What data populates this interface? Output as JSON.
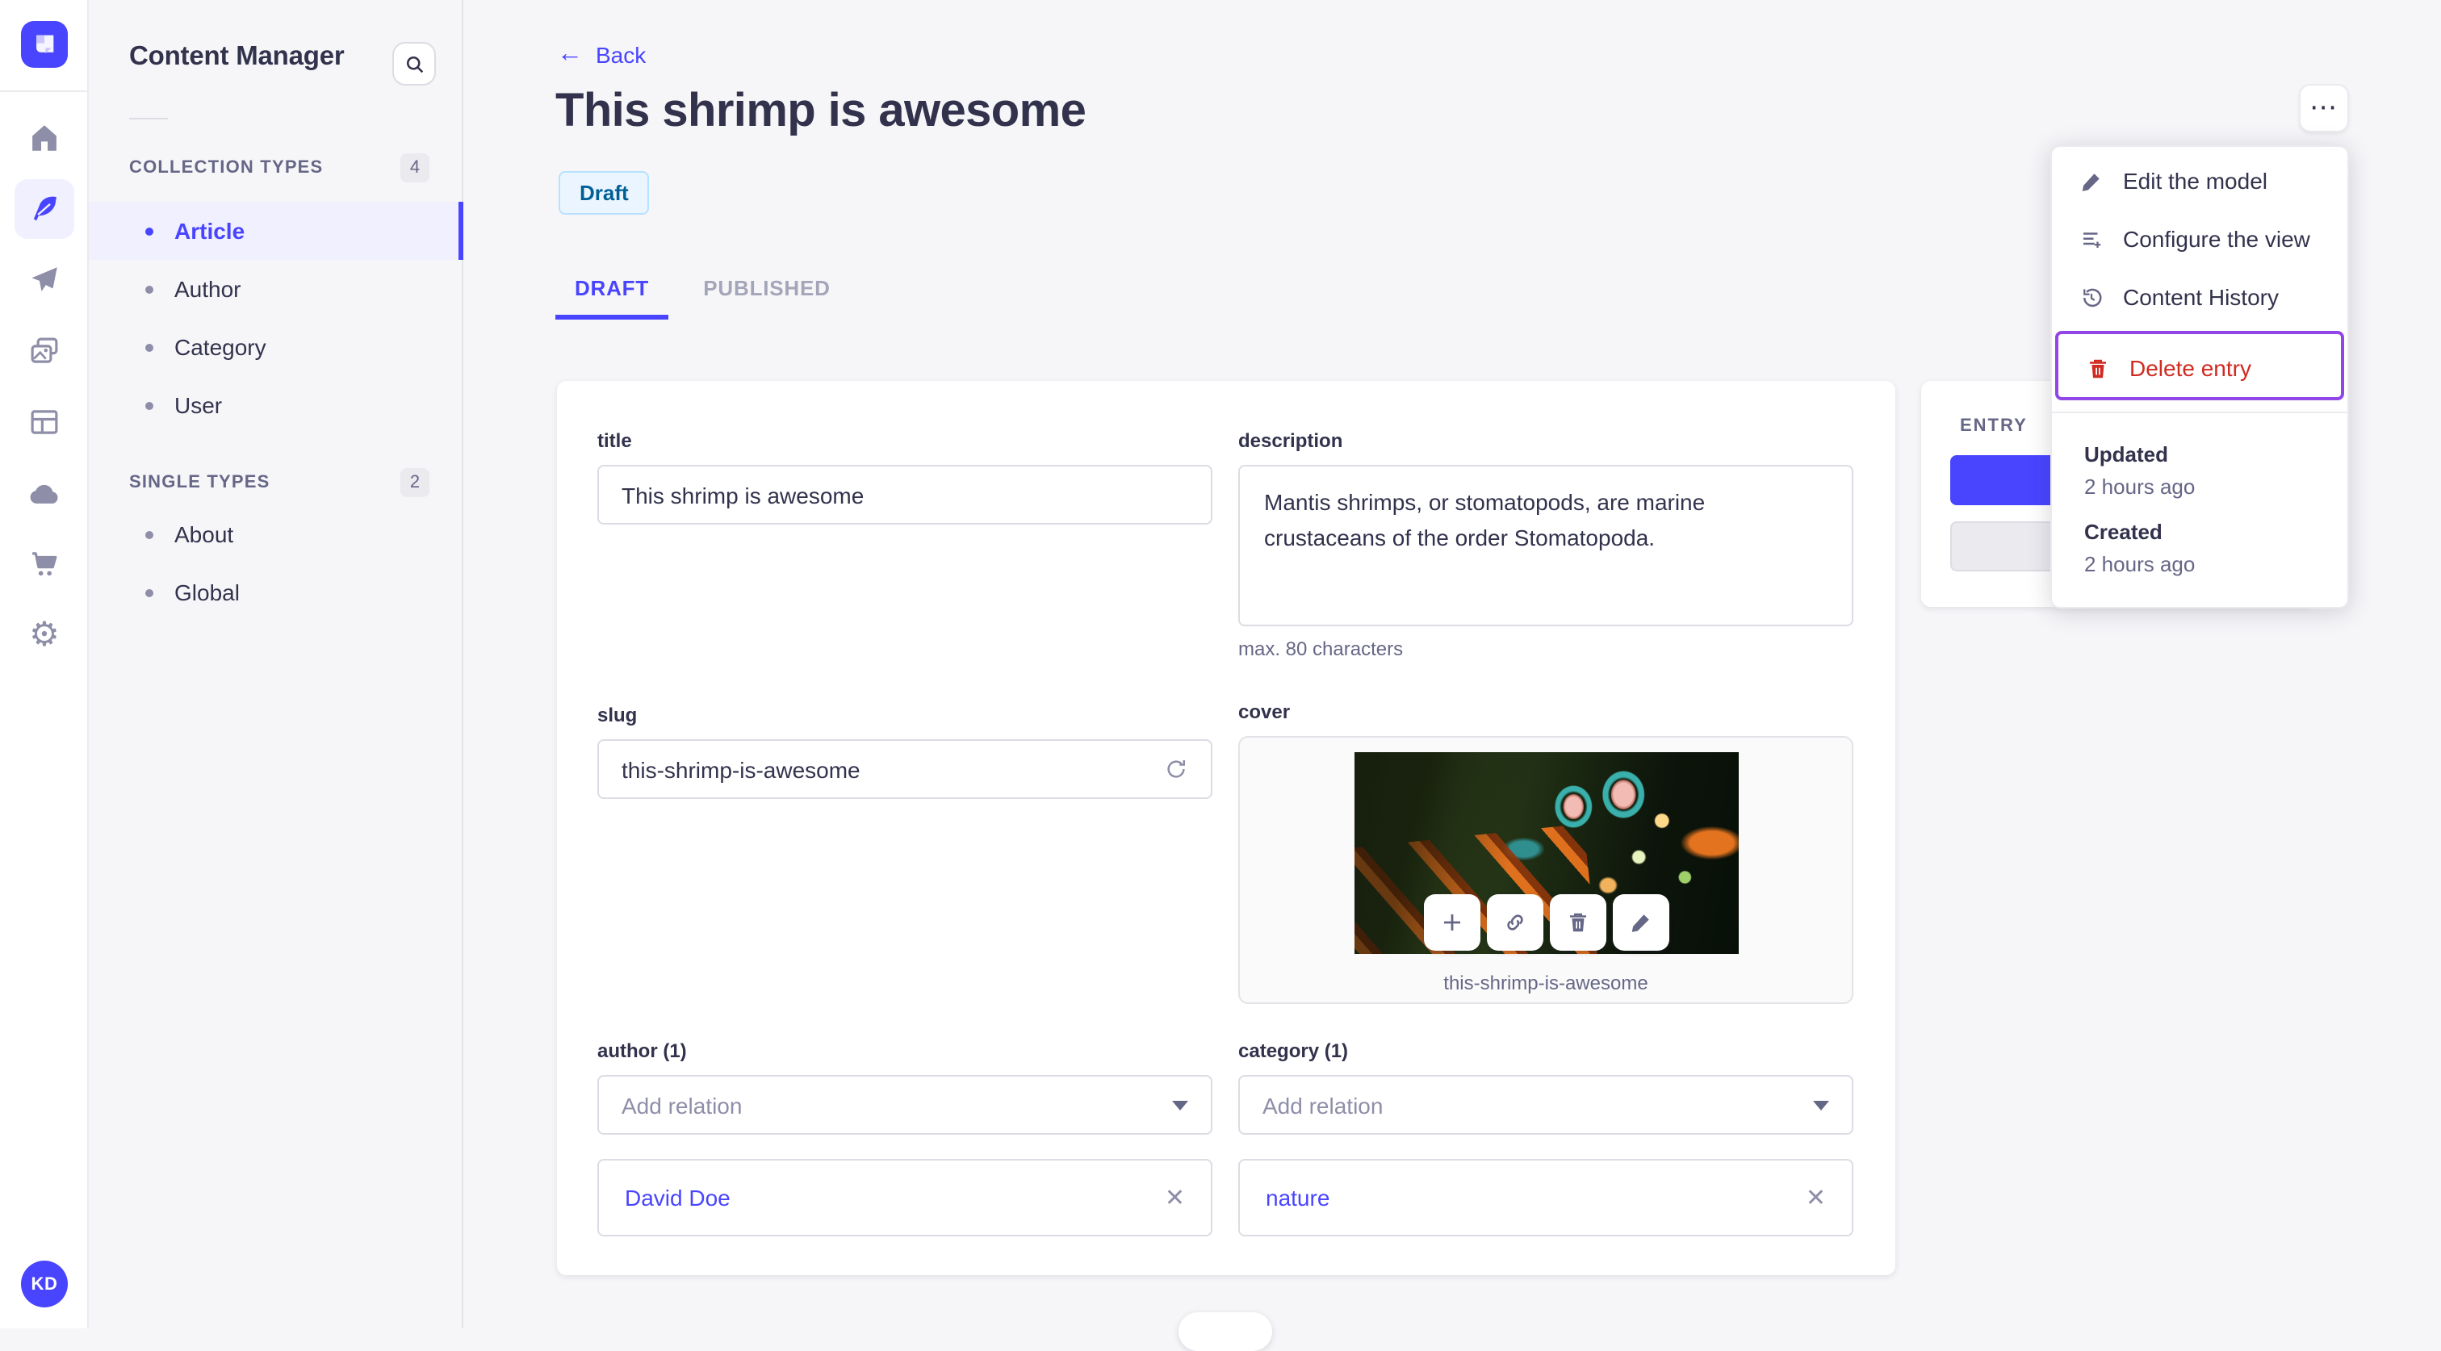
{
  "nav_rail": {
    "logo_icon": "strapi-logo",
    "icons": [
      {
        "name": "home-icon",
        "active": false
      },
      {
        "name": "content-manager-feather-icon",
        "active": true
      },
      {
        "name": "release-paper-plane-icon",
        "active": false
      },
      {
        "name": "media-library-images-icon",
        "active": false
      },
      {
        "name": "layout-icon",
        "active": false
      },
      {
        "name": "cloud-icon",
        "active": false
      },
      {
        "name": "marketplace-cart-icon",
        "active": false
      },
      {
        "name": "settings-gear-icon",
        "active": false
      }
    ],
    "settings_gear_glyph": "⚙",
    "user_initials": "KD"
  },
  "sidebar": {
    "title": "Content Manager",
    "search_icon": "search-icon",
    "sections": [
      {
        "label": "COLLECTION TYPES",
        "count": "4",
        "items": [
          {
            "label": "Article",
            "active": true
          },
          {
            "label": "Author",
            "active": false
          },
          {
            "label": "Category",
            "active": false
          },
          {
            "label": "User",
            "active": false
          }
        ]
      },
      {
        "label": "SINGLE TYPES",
        "count": "2",
        "items": [
          {
            "label": "About",
            "active": false
          },
          {
            "label": "Global",
            "active": false
          }
        ]
      }
    ]
  },
  "header": {
    "back_label": "Back",
    "back_arrow": "←",
    "title": "This shrimp is awesome",
    "status_badge": "Draft",
    "tabs": [
      {
        "label": "DRAFT",
        "active": true
      },
      {
        "label": "PUBLISHED",
        "active": false
      }
    ],
    "more_button_glyph": "⋯"
  },
  "form": {
    "title": {
      "label": "title",
      "value": "This shrimp is awesome"
    },
    "description": {
      "label": "description",
      "value": "Mantis shrimps, or stomatopods, are marine crustaceans of the order Stomatopoda.",
      "hint": "max. 80 characters"
    },
    "slug": {
      "label": "slug",
      "value": "this-shrimp-is-awesome",
      "regenerate_icon": "refresh-icon"
    },
    "cover": {
      "label": "cover",
      "caption": "this-shrimp-is-awesome",
      "action_icons": [
        "plus-icon",
        "link-icon",
        "trash-icon",
        "pencil-icon"
      ]
    },
    "author": {
      "label": "author (1)",
      "placeholder": "Add relation",
      "chips": [
        {
          "label": "David Doe",
          "remove_glyph": "✕"
        }
      ]
    },
    "category": {
      "label": "category (1)",
      "placeholder": "Add relation",
      "chips": [
        {
          "label": "nature",
          "remove_glyph": "✕"
        }
      ]
    }
  },
  "entry_panel": {
    "title": "ENTRY"
  },
  "menu": {
    "items": [
      {
        "label": "Edit the model",
        "icon": "pencil-icon",
        "danger": false
      },
      {
        "label": "Configure the view",
        "icon": "configure-list-icon",
        "danger": false
      },
      {
        "label": "Content History",
        "icon": "history-clock-icon",
        "danger": false
      },
      {
        "label": "Delete entry",
        "icon": "trash-icon",
        "danger": true,
        "focused": true
      }
    ],
    "meta": [
      {
        "label": "Updated",
        "value": "2 hours ago"
      },
      {
        "label": "Created",
        "value": "2 hours ago"
      }
    ]
  },
  "colors": {
    "accent": "#4945ff",
    "accent_bg": "#f0f0ff",
    "danger": "#d02b20",
    "focus_outline": "#9147e8",
    "draft_badge_bg": "#eaf5ff",
    "draft_badge_border": "#b8e1ff",
    "draft_badge_text": "#006096",
    "page_bg": "#f6f6f9",
    "text_dark": "#32324d",
    "text_gray": "#666687"
  }
}
